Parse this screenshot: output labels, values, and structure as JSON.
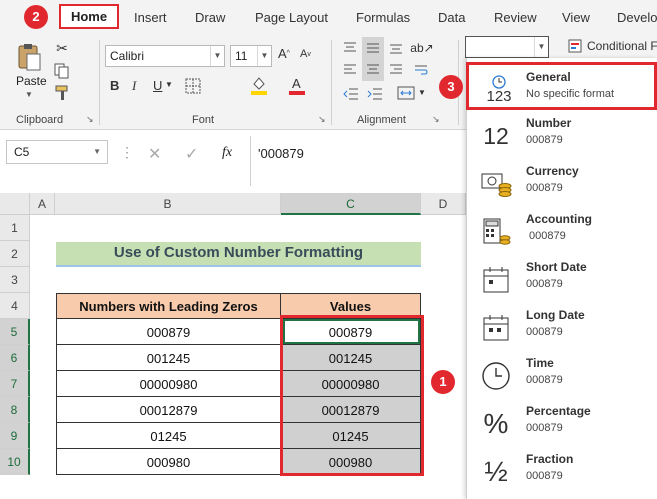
{
  "ribbon_tabs": [
    "Home",
    "Insert",
    "Draw",
    "Page Layout",
    "Formulas",
    "Data",
    "Review",
    "View",
    "Develo"
  ],
  "clipboard": {
    "paste_label": "Paste",
    "group_label": "Clipboard"
  },
  "font": {
    "name": "Calibri",
    "size": "11",
    "group_label": "Font",
    "bold": "B",
    "italic": "I",
    "underline": "U"
  },
  "alignment": {
    "group_label": "Alignment"
  },
  "number_format_box": "",
  "conditional_label": "Conditional F",
  "name_box": "C5",
  "fx_label": "fx",
  "formula_value": "'000879",
  "columns": [
    "A",
    "B",
    "C",
    "D"
  ],
  "rows": [
    "1",
    "2",
    "3",
    "4",
    "5",
    "6",
    "7",
    "8",
    "9",
    "10"
  ],
  "sheet": {
    "title": "Use of Custom Number Formatting",
    "header_b": "Numbers with Leading Zeros",
    "header_c": "Values",
    "data": [
      {
        "b": "000879",
        "c": "000879"
      },
      {
        "b": "001245",
        "c": "001245"
      },
      {
        "b": "00000980",
        "c": "00000980"
      },
      {
        "b": "00012879",
        "c": "00012879"
      },
      {
        "b": "01245",
        "c": "01245"
      },
      {
        "b": "000980",
        "c": "000980"
      }
    ]
  },
  "badges": [
    "1",
    "2",
    "3"
  ],
  "formats": [
    {
      "name": "General",
      "sample": "No specific format",
      "icon": "clock-123-icon"
    },
    {
      "name": "Number",
      "sample": "000879",
      "icon": "12-icon"
    },
    {
      "name": "Currency",
      "sample": "000879",
      "icon": "currency-icon"
    },
    {
      "name": "Accounting",
      "sample": "000879",
      "icon": "calculator-icon"
    },
    {
      "name": "Short Date",
      "sample": "000879",
      "icon": "calendar-icon"
    },
    {
      "name": "Long Date",
      "sample": "000879",
      "icon": "calendar-icon"
    },
    {
      "name": "Time",
      "sample": "000879",
      "icon": "clock-icon"
    },
    {
      "name": "Percentage",
      "sample": "000879",
      "icon": "percent-icon"
    },
    {
      "name": "Fraction",
      "sample": "000879",
      "icon": "fraction-icon"
    }
  ],
  "icon_text": {
    "general": "123",
    "number": "12",
    "percent": "%",
    "fraction": "½",
    "pct_sign": "%"
  },
  "colors": {
    "accent_red": "#e0282e",
    "excel_green": "#217346",
    "title_fill": "#c6e0b4",
    "header_fill": "#f8cbad",
    "selected_fill": "#d0d0d0"
  }
}
